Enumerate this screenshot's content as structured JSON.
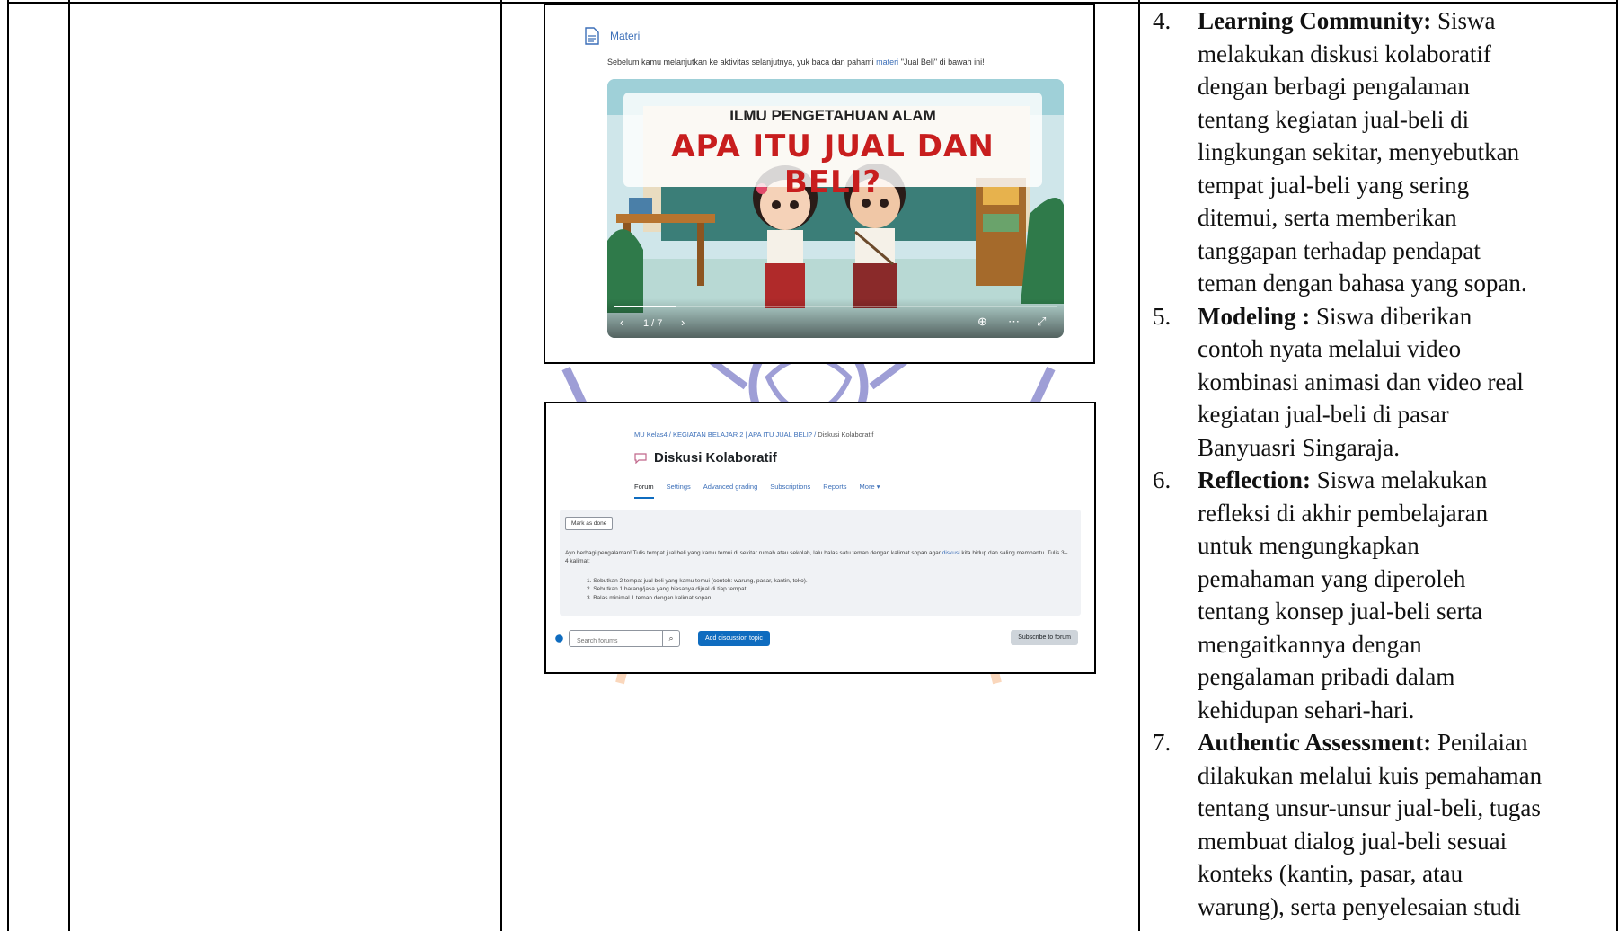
{
  "screenshot_materi": {
    "section_title": "Materi",
    "description_before": "Sebelum kamu melanjutkan ke aktivitas selanjutnya, yuk baca dan pahami ",
    "description_link": "materi",
    "description_after": " \"Jual Beli\" di bawah ini!",
    "slide_subtitle": "ILMU PENGETAHUAN ALAM",
    "slide_title": "APA ITU JUAL DAN BELI?",
    "slide_counter": "1 / 7",
    "slide_progress": 0.14
  },
  "screenshot_forum": {
    "breadcrumb": [
      "MU Kelas4",
      "KEGIATAN BELAJAR 2 | APA ITU JUAL BELI?"
    ],
    "breadcrumb_current": "Diskusi Kolaboratif",
    "title": "Diskusi Kolaboratif",
    "tabs": [
      "Forum",
      "Settings",
      "Advanced grading",
      "Subscriptions",
      "Reports",
      "More ▾"
    ],
    "active_tab": "Forum",
    "mark_done": "Mark as done",
    "intro_before": "Ayo berbagi pengalaman! Tulis tempat jual beli yang kamu temui di sekitar rumah atau sekolah, lalu balas satu teman dengan kalimat sopan agar ",
    "intro_link": "diskusi",
    "intro_after": " kita hidup dan saling membantu. Tulis 3–4 kalimat:",
    "steps": [
      "1. Sebutkan 2 tempat jual beli yang kamu temui (contoh: warung, pasar, kantin, toko).",
      "2. Sebutkan 1 barang/jasa yang biasanya dijual di tiap tempat.",
      "3. Balas minimal 1 teman dengan kalimat sopan."
    ],
    "search_placeholder": "Search forums",
    "add_button": "Add discussion topic",
    "subscribe_button": "Subscribe to forum"
  },
  "right_column": {
    "items": [
      {
        "number": "4.",
        "lines": [
          {
            "bold": "Learning Community:",
            "text": " Siswa"
          },
          {
            "bold": "",
            "text": "melakukan diskusi kolaboratif"
          },
          {
            "bold": "",
            "text": "dengan berbagi pengalaman"
          },
          {
            "bold": "",
            "text": "tentang kegiatan jual-beli di"
          },
          {
            "bold": "",
            "text": "lingkungan sekitar, menyebutkan"
          },
          {
            "bold": "",
            "text": "tempat jual-beli yang sering"
          },
          {
            "bold": "",
            "text": "ditemui, serta memberikan"
          },
          {
            "bold": "",
            "text": "tanggapan terhadap pendapat"
          },
          {
            "bold": "",
            "text": "teman dengan bahasa yang sopan."
          }
        ]
      },
      {
        "number": "5.",
        "lines": [
          {
            "bold": "Modeling :",
            "text": " Siswa diberikan"
          },
          {
            "bold": "",
            "text": "contoh nyata melalui video"
          },
          {
            "bold": "",
            "text": "kombinasi animasi dan video real"
          },
          {
            "bold": "",
            "text": "kegiatan jual-beli di pasar"
          },
          {
            "bold": "",
            "text": "Banyuasri Singaraja."
          }
        ]
      },
      {
        "number": "6.",
        "lines": [
          {
            "bold": "Reflection:",
            "text": " Siswa melakukan"
          },
          {
            "bold": "",
            "text": "refleksi di akhir pembelajaran"
          },
          {
            "bold": "",
            "text": "untuk mengungkapkan"
          },
          {
            "bold": "",
            "text": "pemahaman yang diperoleh"
          },
          {
            "bold": "",
            "text": "tentang konsep jual-beli serta"
          },
          {
            "bold": "",
            "text": "mengaitkannya dengan"
          },
          {
            "bold": "",
            "text": "pengalaman pribadi dalam"
          },
          {
            "bold": "",
            "text": "kehidupan sehari-hari."
          }
        ]
      },
      {
        "number": "7.",
        "lines": [
          {
            "bold": "Authentic Assessment:",
            "text": " Penilaian"
          },
          {
            "bold": "",
            "text": "dilakukan melalui kuis pemahaman"
          },
          {
            "bold": "",
            "text": "tentang unsur-unsur jual-beli, tugas"
          },
          {
            "bold": "",
            "text": "membuat dialog jual-beli sesuai"
          },
          {
            "bold": "",
            "text": "konteks (kantin, pasar, atau"
          },
          {
            "bold": "",
            "text": "warung), serta penyelesaian studi"
          }
        ]
      }
    ]
  },
  "colors": {
    "link": "#3c6fb8",
    "slide_title": "#c81e1e",
    "primary_button": "#0f6cbf",
    "watermark": "#7e7ec8",
    "watermark_accent": "#f28a3a"
  }
}
